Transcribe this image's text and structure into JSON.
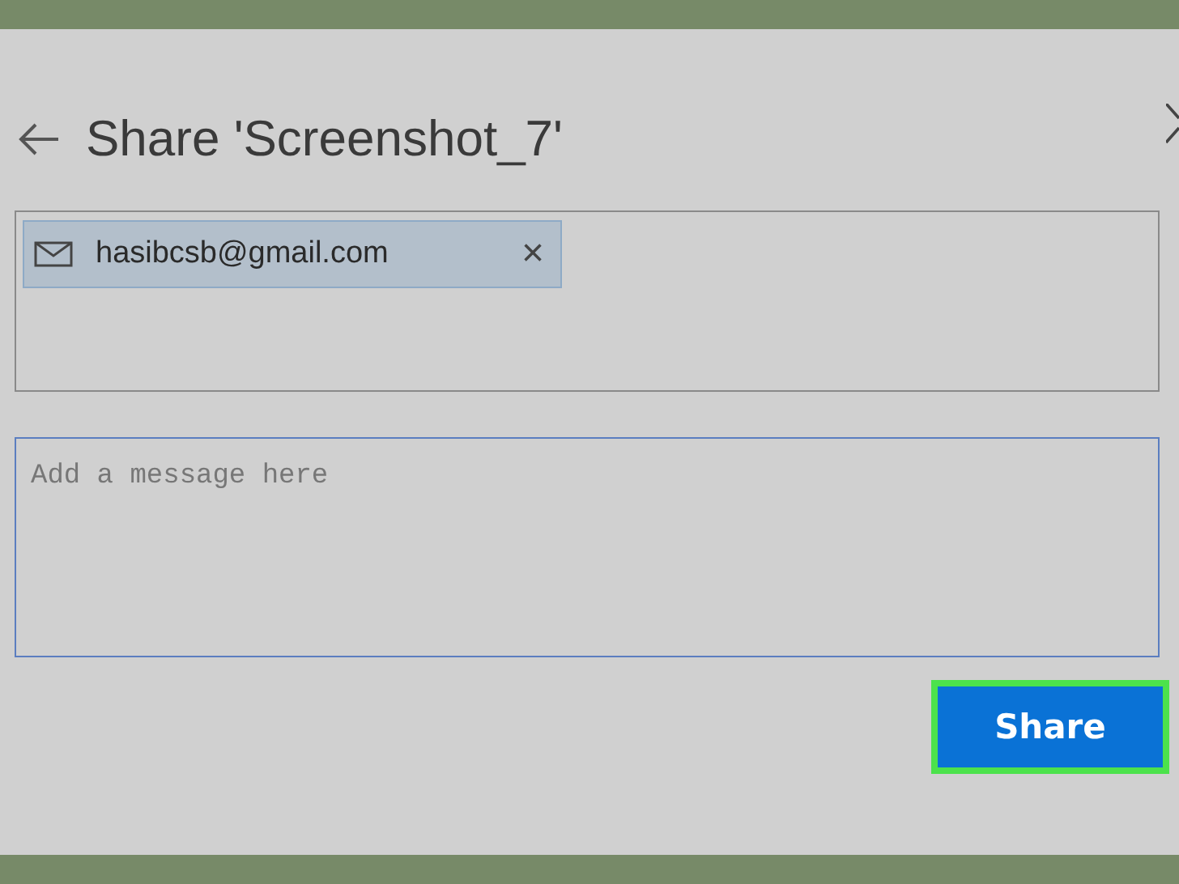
{
  "dialog": {
    "title": "Share 'Screenshot_7'"
  },
  "recipients": [
    {
      "email": "hasibcsb@gmail.com",
      "remove": "×"
    }
  ],
  "message": {
    "placeholder": "Add a message here"
  },
  "share_button": {
    "label": "Share",
    "highlighted": true
  }
}
